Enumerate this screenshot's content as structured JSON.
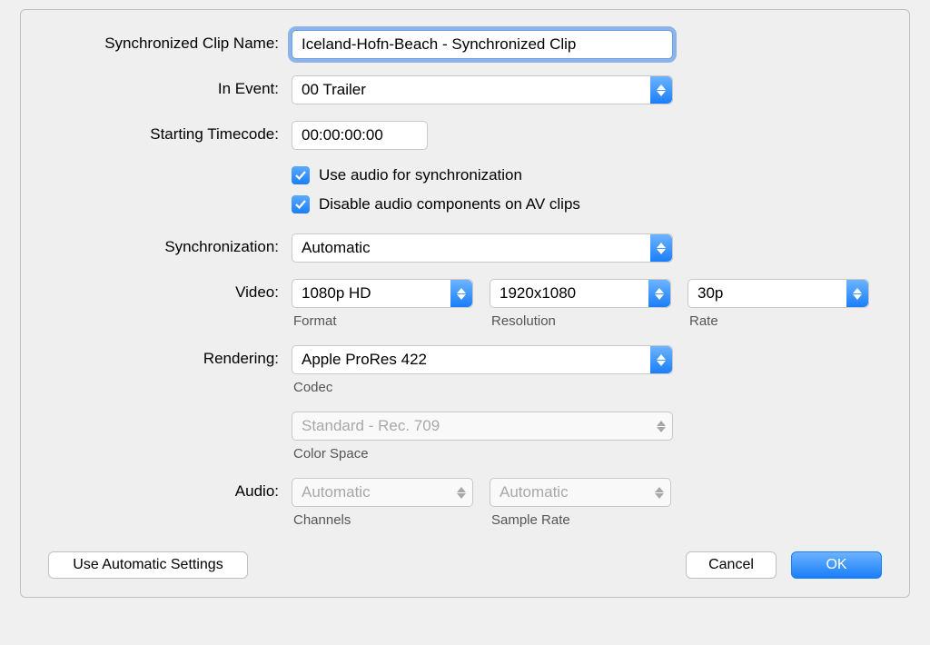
{
  "labels": {
    "clip_name": "Synchronized Clip Name:",
    "in_event": "In Event:",
    "starting_timecode": "Starting Timecode:",
    "synchronization": "Synchronization:",
    "video": "Video:",
    "rendering": "Rendering:",
    "audio": "Audio:"
  },
  "fields": {
    "clip_name": "Iceland-Hofn-Beach - Synchronized Clip",
    "in_event": "00 Trailer",
    "starting_timecode": "00:00:00:00",
    "synchronization": "Automatic",
    "video_format": "1080p HD",
    "video_resolution": "1920x1080",
    "video_rate": "30p",
    "rendering_codec": "Apple ProRes 422",
    "rendering_colorspace": "Standard - Rec. 709",
    "audio_channels": "Automatic",
    "audio_sample_rate": "Automatic"
  },
  "sublabels": {
    "format": "Format",
    "resolution": "Resolution",
    "rate": "Rate",
    "codec": "Codec",
    "colorspace": "Color Space",
    "channels": "Channels",
    "sample_rate": "Sample Rate"
  },
  "checkboxes": {
    "use_audio": "Use audio for synchronization",
    "disable_audio": "Disable audio components on AV clips"
  },
  "buttons": {
    "auto_settings": "Use Automatic Settings",
    "cancel": "Cancel",
    "ok": "OK"
  }
}
